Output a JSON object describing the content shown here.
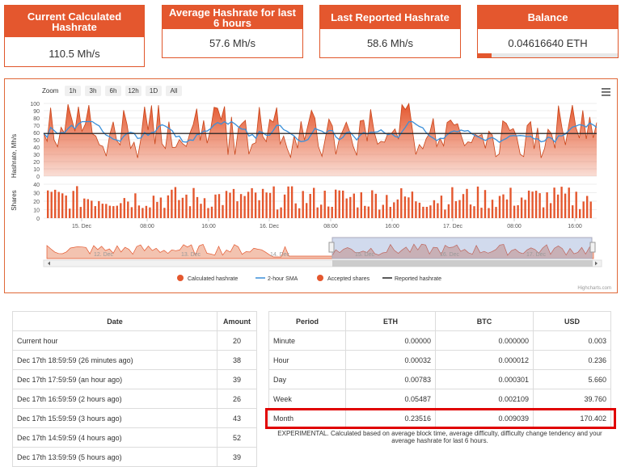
{
  "cards": [
    {
      "title": "Current Calculated Hashrate",
      "value": "110.5 Mh/s"
    },
    {
      "title": "Average Hashrate for last 6 hours",
      "value": "57.6 Mh/s"
    },
    {
      "title": "Last Reported Hashrate",
      "value": "58.6 Mh/s"
    },
    {
      "title": "Balance",
      "value": "0.04616640 ETH",
      "progress_fraction": 0.1
    }
  ],
  "chart": {
    "zoom_label": "Zoom",
    "zoom_buttons": [
      "1h",
      "3h",
      "6h",
      "12h",
      "1D",
      "All"
    ],
    "x_labels": [
      "15. Dec",
      "08:00",
      "16:00",
      "16. Dec",
      "08:00",
      "16:00",
      "17. Dec",
      "08:00",
      "16:00"
    ],
    "navigator_labels": [
      "12. Dec",
      "13. Dec",
      "14. Dec",
      "15. Dec",
      "16. Dec",
      "17. Dec"
    ],
    "legend": [
      "Calculated hashrate",
      "2-hour SMA",
      "Accepted shares",
      "Reported hashrate"
    ],
    "credits": "Highcharts.com",
    "menu_icon": "hamburger-icon"
  },
  "chart_data": {
    "type": "area",
    "panes": [
      {
        "ylabel": "Hashrate, Mh/s",
        "ylim": [
          0,
          100
        ],
        "yticks": [
          0,
          10,
          20,
          30,
          40,
          50,
          60,
          70,
          80,
          90,
          100
        ]
      },
      {
        "ylabel": "Shares",
        "ylim": [
          0,
          40
        ],
        "yticks": [
          0,
          10,
          20,
          30,
          40
        ]
      }
    ],
    "series": [
      {
        "name": "Calculated hashrate",
        "color": "#e4572e",
        "approx_range": [
          25,
          100
        ]
      },
      {
        "name": "2-hour SMA",
        "color": "#3a8fd9",
        "approx_range": [
          45,
          75
        ]
      },
      {
        "name": "Reported hashrate",
        "color": "#222222",
        "approx_value": 58.6
      },
      {
        "name": "Accepted shares",
        "color": "#e4572e",
        "approx_range": [
          10,
          38
        ]
      }
    ]
  },
  "table1": {
    "headers": [
      "Date",
      "Amount"
    ],
    "rows": [
      [
        "Current hour",
        "20"
      ],
      [
        "Dec 17th 18:59:59 (26 minutes ago)",
        "38"
      ],
      [
        "Dec 17th 17:59:59 (an hour ago)",
        "39"
      ],
      [
        "Dec 17th 16:59:59 (2 hours ago)",
        "26"
      ],
      [
        "Dec 17th 15:59:59 (3 hours ago)",
        "43"
      ],
      [
        "Dec 17th 14:59:59 (4 hours ago)",
        "52"
      ],
      [
        "Dec 17th 13:59:59 (5 hours ago)",
        "39"
      ]
    ]
  },
  "table2": {
    "headers": [
      "Period",
      "ETH",
      "BTC",
      "USD"
    ],
    "rows": [
      [
        "Minute",
        "0.00000",
        "0.000000",
        "0.003"
      ],
      [
        "Hour",
        "0.00032",
        "0.000012",
        "0.236"
      ],
      [
        "Day",
        "0.00783",
        "0.000301",
        "5.660"
      ],
      [
        "Week",
        "0.05487",
        "0.002109",
        "39.760"
      ],
      [
        "Month",
        "0.23516",
        "0.009039",
        "170.402"
      ]
    ],
    "note": "EXPERIMENTAL. Calculated based on average block time, average difficulty, difficulty change tendency and your average hashrate for last 6 hours."
  }
}
